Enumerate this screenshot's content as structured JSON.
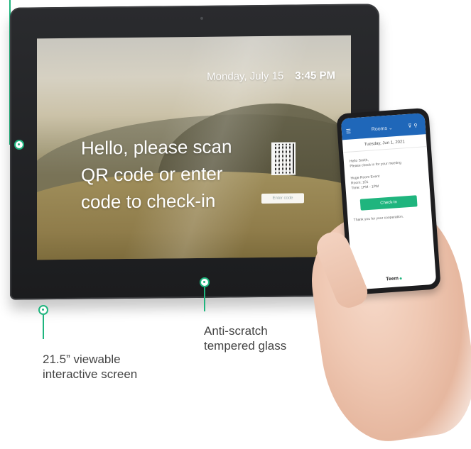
{
  "colors": {
    "accent": "#1fb57e",
    "phone_header": "#1f67b9"
  },
  "tablet_screen": {
    "date": "Monday, July 15",
    "time": "3:45 PM",
    "greeting": "Hello, please scan QR code or enter code to check-in",
    "code_placeholder": "Enter code"
  },
  "phone_screen": {
    "date_header": "Tuesday, Jun 1, 2021",
    "greeting": "Hello Smith,",
    "instruction": "Please check in for your meeting",
    "meeting_title": "Huge Room Event",
    "meeting_room": "Room: 101",
    "meeting_time": "Time: 1PM - 1PM",
    "checkin_label": "Check-in",
    "thanks": "Thank you for your cooperation.",
    "logo": "Teem"
  },
  "callouts": {
    "screen": "21.5” viewable\ninteractive screen",
    "glass": "Anti-scratch\ntempered glass"
  }
}
